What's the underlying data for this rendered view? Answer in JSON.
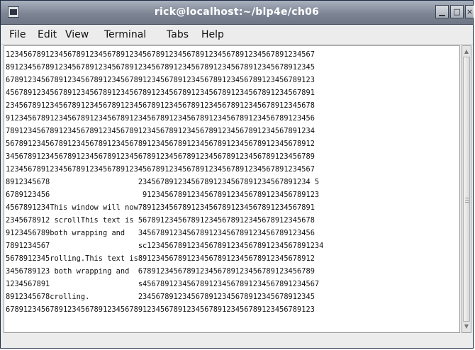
{
  "window": {
    "title": "rick@localhost:~/blp4e/ch06",
    "minimize_label": "▁",
    "maximize_label": "□",
    "close_label": "×"
  },
  "menubar": {
    "items": [
      "File",
      "Edit",
      "View",
      "Terminal",
      "Tabs",
      "Help"
    ]
  },
  "terminal": {
    "lines": [
      "1234567891234567891234567891234567891234567891234567891234567891234567",
      "8912345678912345678912345678912345678912345678912345678912345678912345",
      "6789123456789123456789123456789123456789123456789123456789123456789123",
      "4567891234567891234567891234567891234567891234567891234567891234567891",
      "2345678912345678912345678912345678912345678912345678912345678912345678",
      "9123456789123456789123456789123456789123456789123456789123456789123456",
      "7891234567891234567891234567891234567891234567891234567891234567891234",
      "5678912345678912345678912345678912345678912345678912345678912345678912",
      "3456789123456789123456789123456789123456789123456789123456789123456789",
      "1234567891234567891234567891234567891234567891234567891234567891234567",
      "8912345678                    234567891234567891234567891234567891234 5",
      "6789123456                     9123456789123456789123456789123456789123",
      "4567891234This window will now7891234567891234567891234567891234567891",
      "2345678912 scrollThis text is 5678912345678912345678912345678912345678",
      "9123456789both wrapping and   3456789123456789123456789123456789123456",
      "7891234567                    sc1234567891234567891234567891234567891234",
      "5678912345rolling.This text is8912345678912345678912345678912345678912",
      "3456789123 both wrapping and  6789123456789123456789123456789123456789",
      "1234567891                    s4567891234567891234567891234567891234567",
      "8912345678crolling.           2345678912345678912345678912345678912345",
      "6789123456789123456789123456789123456789123456789123456789123456789123"
    ]
  },
  "icons": {
    "app": "terminal-icon",
    "scroll_up": "arrow-up-icon",
    "scroll_down": "arrow-down-icon"
  }
}
